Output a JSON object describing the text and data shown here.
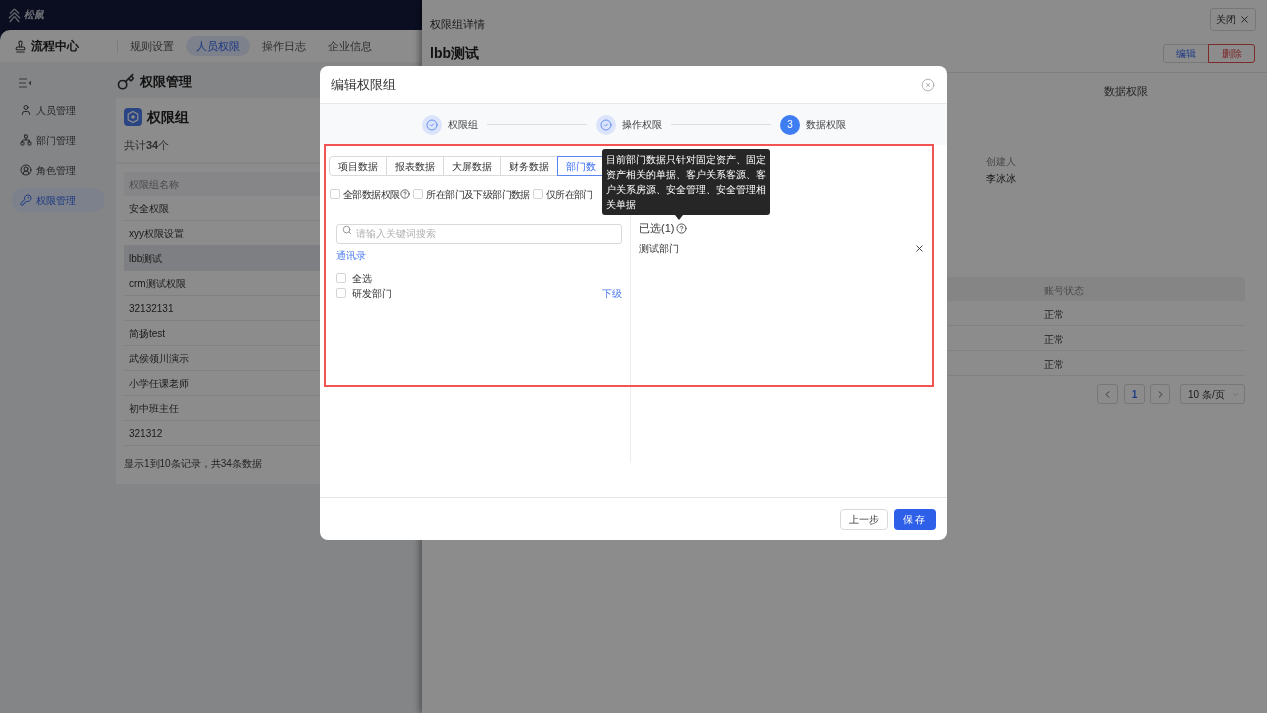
{
  "top_bar": {
    "logo_text": "松鼠"
  },
  "header": {
    "app_title": "流程中心",
    "tabs": [
      {
        "label": "规则设置",
        "selected": false
      },
      {
        "label": "人员权限",
        "selected": true
      },
      {
        "label": "操作日志",
        "selected": false
      },
      {
        "label": "企业信息",
        "selected": false
      }
    ]
  },
  "sidebar": {
    "items": [
      {
        "label": "人员管理",
        "selected": false
      },
      {
        "label": "部门管理",
        "selected": false
      },
      {
        "label": "角色管理",
        "selected": false
      },
      {
        "label": "权限管理",
        "selected": true
      }
    ]
  },
  "page": {
    "title": "权限管理",
    "summary": {
      "title": "权限组",
      "count": "共计**34**个"
    },
    "table": {
      "columns": [
        "权限组名称"
      ],
      "rows": [
        {
          "name": "安全权限",
          "selected": false
        },
        {
          "name": "xyy权限设置",
          "selected": false
        },
        {
          "name": "lbb测试",
          "selected": true
        },
        {
          "name": "crm测试权限",
          "selected": false
        },
        {
          "name": "32132131",
          "selected": false
        },
        {
          "name": "简扬test",
          "selected": false
        },
        {
          "name": "武侯领川演示",
          "selected": false
        },
        {
          "name": "小学任课老师",
          "selected": false
        },
        {
          "name": "初中班主任",
          "selected": false
        },
        {
          "name": "321312",
          "selected": false
        }
      ],
      "footer": "显示1到10条记录，共34条数据"
    }
  },
  "drawer": {
    "title": "权限组详情",
    "close_button": "关闭",
    "name": "lbb测试",
    "actions": [
      {
        "label": "编辑",
        "kind": "edit"
      },
      {
        "label": "删除",
        "kind": "danger"
      }
    ],
    "section_tab": "数据权限",
    "fields": [
      {
        "label": "创建人",
        "value": "李冰冰"
      }
    ],
    "members_table": {
      "columns": [
        "账号状态"
      ],
      "rows": [
        {
          "account_status": "正常"
        },
        {
          "account_status": "正常"
        },
        {
          "account_status": "正常"
        }
      ]
    },
    "pagination": {
      "pages": [
        {
          "label": "1",
          "selected": true
        }
      ],
      "page_size": "10 条/页"
    }
  },
  "modal": {
    "title": "编辑权限组",
    "steps": [
      {
        "label": "权限组",
        "completed": true
      },
      {
        "label": "操作权限",
        "completed": true
      },
      {
        "number": "3",
        "label": "数据权限",
        "completed": false
      }
    ],
    "data_tabs": [
      {
        "label": "项目数据",
        "selected": false
      },
      {
        "label": "报表数据",
        "selected": false
      },
      {
        "label": "大屏数据",
        "selected": false
      },
      {
        "label": "财务数据",
        "selected": false
      },
      {
        "label": "部门数",
        "selected": true
      }
    ],
    "scope_options": [
      {
        "label": "全部数据权限",
        "checked": false,
        "help": true
      },
      {
        "label": "所在部门及下级部门数据",
        "checked": false,
        "help": false
      },
      {
        "label": "仅所在部门",
        "checked": false,
        "help": false
      }
    ],
    "search": {
      "placeholder": "请输入关键词搜索"
    },
    "breadcrumb": "通讯录",
    "departments": [
      {
        "label": "全选",
        "checked": false
      },
      {
        "label": "研发部门",
        "checked": false,
        "sub_link": "下级"
      }
    ],
    "selected_panel": {
      "title": "已选(1)",
      "help": true,
      "items": [
        {
          "label": "测试部门"
        }
      ]
    },
    "tooltip": "目前部门数据只针对固定资产、固定资产相关的单据、客户关系客源、客户关系房源、安全管理、安全管理相关单据",
    "buttons": [
      {
        "label": "上一步",
        "kind": "default"
      },
      {
        "label": "保存",
        "kind": "primary"
      }
    ]
  }
}
